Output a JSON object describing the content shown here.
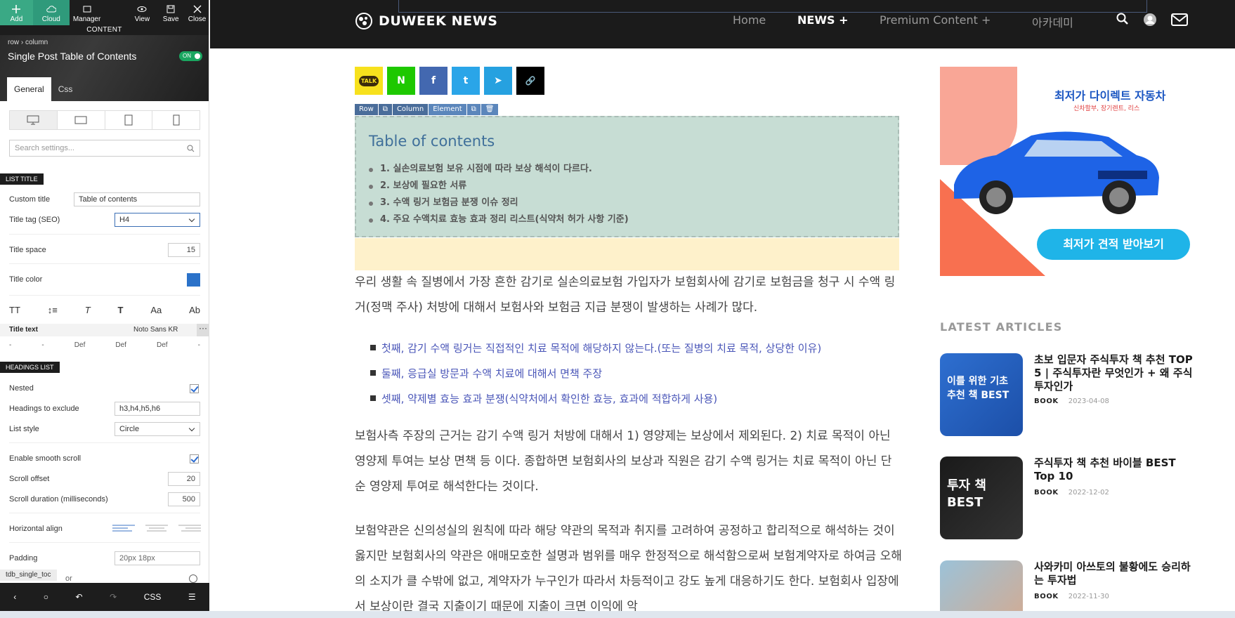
{
  "panel": {
    "toolbar": {
      "add": "Add",
      "cloud": "Cloud",
      "manager": "Manager",
      "view": "View",
      "save": "Save",
      "close": "Close"
    },
    "section_label": "CONTENT",
    "breadcrumb": "row  ›  column",
    "title": "Single Post Table of Contents",
    "on_badge": "ON",
    "tabs": [
      "General",
      "Css"
    ],
    "search_placeholder": "Search settings...",
    "list_title_header": "LIST TITLE",
    "custom_title_label": "Custom title",
    "custom_title_value": "Table of contents",
    "title_tag_label": "Title tag (SEO)",
    "title_tag_value": "H4",
    "title_space_label": "Title space",
    "title_space_value": "15",
    "title_color_label": "Title color",
    "title_color": "#2b72c9",
    "title_text_label": "Title text",
    "title_text_font": "Noto Sans KR",
    "def_row": [
      "-",
      "-",
      "Def",
      "Def",
      "Def",
      "-"
    ],
    "headings_list_header": "HEADINGS LIST",
    "nested_label": "Nested",
    "exclude_label": "Headings to exclude",
    "exclude_value": "h3,h4,h5,h6",
    "list_style_label": "List style",
    "list_style_value": "Circle",
    "smooth_label": "Enable smooth scroll",
    "offset_label": "Scroll offset",
    "offset_value": "20",
    "duration_label": "Scroll duration (milliseconds)",
    "duration_value": "500",
    "halign_label": "Horizontal align",
    "padding_label": "Padding",
    "padding_value": "20px 18px",
    "partial_label": "or",
    "tdb_label": "tdb_single_toc",
    "bottom_css": "CSS"
  },
  "nav": {
    "logo": "DUWEEK NEWS",
    "links": [
      "Home",
      "NEWS  +",
      "Premium Content  +",
      "아카데미"
    ]
  },
  "share": [
    "TALK",
    "N",
    "f",
    "t",
    "➤",
    "🔗"
  ],
  "element_tag": [
    "Row",
    "Column",
    "Element"
  ],
  "toc": {
    "title": "Table of contents",
    "items": [
      "1. 실손의료보험 보유 시점에 따라 보상 해석이 다르다.",
      "2. 보상에 필요한 서류",
      "3. 수액 링거 보험금 분쟁 이슈 정리",
      "4. 주요 수액치료 효능 효과 정리 리스트(식약처 허가 사항 기준)"
    ]
  },
  "article": {
    "p1": "우리 생활 속 질병에서 가장 흔한 감기로 실손의료보험 가입자가 보험회사에 감기로 보험금을 청구 시 수액 링거(정맥 주사) 처방에 대해서 보험사와 보험금 지급 분쟁이 발생하는 사례가 많다.",
    "bullets": [
      "첫째, 감기 수액 링거는 직접적인 치료 목적에 해당하지 않는다.(또는 질병의 치료 목적, 상당한 이유)",
      "둘째, 응급실 방문과 수액 치료에 대해서 면책 주장",
      "셋째, 약제별 효능 효과 분쟁(식약처에서 확인한 효능, 효과에 적합하게 사용)"
    ],
    "p2": "보험사측 주장의 근거는 감기 수액 링거 처방에 대해서 1) 영양제는 보상에서 제외된다. 2) 치료 목적이 아닌 영양제 투여는 보상 면책 등 이다. 종합하면 보험회사의 보상과 직원은 감기 수액 링거는 치료 목적이 아닌 단순 영양제 투여로 해석한다는 것이다.",
    "p3": "보험약관은 신의성실의 원칙에 따라 해당 약관의 목적과 취지를 고려하여 공정하고 합리적으로 해석하는 것이 옳지만 보험회사의 약관은 애매모호한 설명과 범위를 매우 한정적으로 해석함으로써 보험계약자로 하여금 오해의 소지가 클 수밖에 없고, 계약자가 누구인가 따라서 차등적이고 강도 높게 대응하기도 한다. 보험회사 입장에서 보상이란 결국 지출이기 때문에 지출이 크면 이익에 악"
  },
  "ad": {
    "title": "최저가 다이렉트 자동차",
    "subtitle": "신차할부, 장기렌트, 리스",
    "button": "최저가 견적 받아보기"
  },
  "latest_heading": "LATEST ARTICLES",
  "articles": [
    {
      "title": "초보 입문자 주식투자 책 추천 TOP 5 | 주식투자란 무엇인가 + 왜 주식투자인가",
      "category": "BOOK",
      "date": "2023-04-08",
      "thumb_text": "이를 위한 기초\n추천 책 BEST"
    },
    {
      "title": "주식투자 책 추천 바이블 BEST Top 10",
      "category": "BOOK",
      "date": "2022-12-02",
      "thumb_text": "투자 책\nBEST"
    },
    {
      "title": "사와카미 아쓰토의 불황에도 승리하는 투자법",
      "category": "BOOK",
      "date": "2022-11-30",
      "thumb_text": ""
    }
  ]
}
